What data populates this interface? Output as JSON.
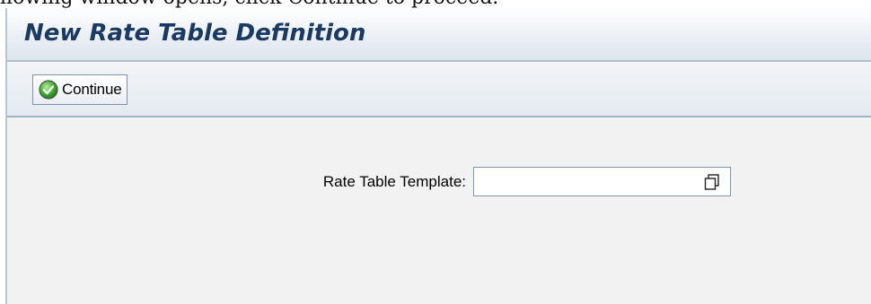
{
  "page_fragment": "llowing window opens, click Continue to proceed.",
  "dialog": {
    "title": "New Rate Table Definition"
  },
  "toolbar": {
    "continue_label": "Continue",
    "continue_icon": "checkmark-circle-icon"
  },
  "form": {
    "rate_table_template_label": "Rate Table Template:",
    "rate_table_template_value": "",
    "value_help_icon": "value-help-icon"
  },
  "colors": {
    "title_text": "#1a3a64",
    "check_green": "#3aa52a",
    "content_bg": "#f2f2f2"
  }
}
